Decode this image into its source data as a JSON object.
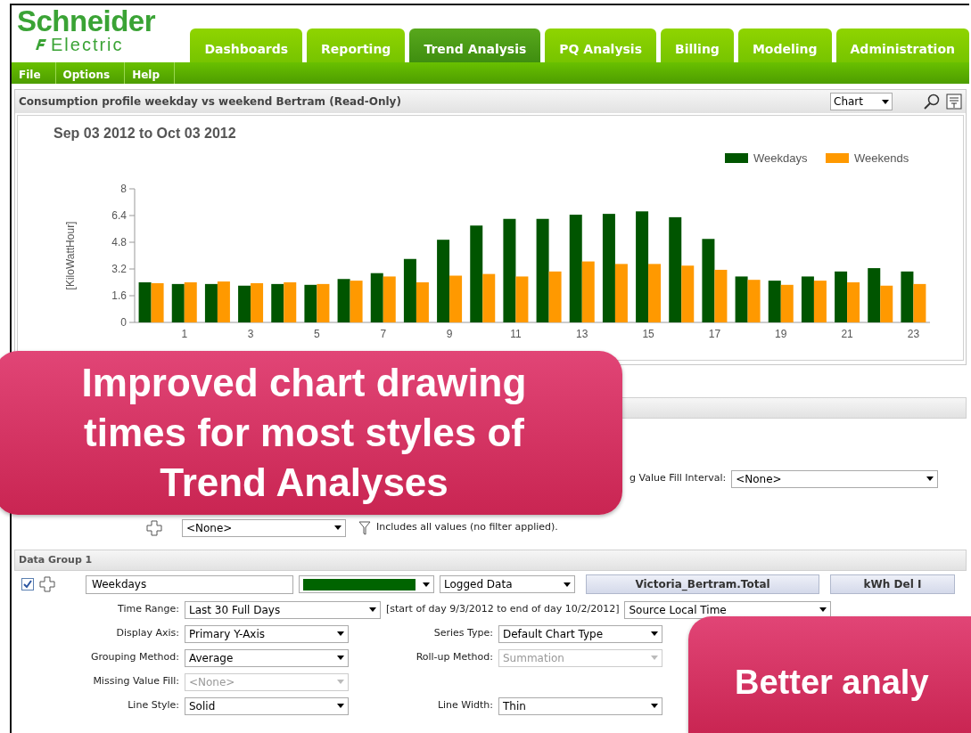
{
  "logo": {
    "name": "Schneider",
    "sub": "Electric"
  },
  "tabs": [
    {
      "label": "Dashboards",
      "selected": false
    },
    {
      "label": "Reporting",
      "selected": false
    },
    {
      "label": "Trend Analysis",
      "selected": true
    },
    {
      "label": "PQ Analysis",
      "selected": false
    },
    {
      "label": "Billing",
      "selected": false
    },
    {
      "label": "Modeling",
      "selected": false
    },
    {
      "label": "Administration",
      "selected": false
    }
  ],
  "menu": [
    "File",
    "Options",
    "Help"
  ],
  "panel": {
    "title": "Consumption profile weekday vs weekend Bertram (Read-Only)",
    "view": "Chart",
    "chart_title": "Sep 03 2012 to Oct 03 2012",
    "chart_data": {
      "type": "bar",
      "ylabel": "[KiloWattHour]",
      "legend": "top-right",
      "x": [
        0,
        1,
        2,
        3,
        4,
        5,
        6,
        7,
        8,
        9,
        10,
        11,
        12,
        13,
        14,
        15,
        16,
        17,
        18,
        19,
        20,
        21,
        22,
        23
      ],
      "xlim": [
        -0.5,
        23.5
      ],
      "ylim": [
        0,
        8
      ],
      "yticks": [
        0,
        1.6,
        3.2,
        4.8,
        6.4,
        8
      ],
      "xticks": [
        1,
        3,
        5,
        7,
        9,
        11,
        13,
        15,
        17,
        19,
        21,
        23
      ],
      "series": [
        {
          "name": "Weekdays",
          "color": "#005500",
          "values": [
            2.4,
            2.3,
            2.3,
            2.2,
            2.3,
            2.25,
            2.6,
            2.95,
            3.8,
            4.95,
            5.8,
            6.2,
            6.2,
            6.45,
            6.5,
            6.65,
            6.3,
            5.0,
            2.75,
            2.5,
            2.75,
            3.05,
            3.25,
            3.05
          ]
        },
        {
          "name": "Weekends",
          "color": "#ff9900",
          "values": [
            2.35,
            2.4,
            2.45,
            2.35,
            2.4,
            2.3,
            2.5,
            2.75,
            2.4,
            2.8,
            2.9,
            2.75,
            3.05,
            3.65,
            3.5,
            3.5,
            3.4,
            3.15,
            2.55,
            2.25,
            2.5,
            2.4,
            2.2,
            2.3
          ]
        }
      ]
    }
  },
  "chart_options": {
    "fill_label": "g Value Fill Interval:",
    "fill_value": "<None>",
    "filter_value": "<None>",
    "filter_text": "Includes all values (no filter applied)."
  },
  "data_group": {
    "title": "Data Group 1",
    "checked": true,
    "name": "Weekdays",
    "color": "#006400",
    "source": "Logged Data",
    "buttons": [
      "Victoria_Bertram.Total",
      "kWh Del I"
    ],
    "rows": [
      {
        "items": [
          {
            "kind": "field",
            "label": "Time Range:",
            "value": "Last 30 Full Days",
            "disabled": false
          },
          {
            "kind": "note",
            "text": "[start of day 9/3/2012 to end of day 10/2/2012]"
          },
          {
            "kind": "field",
            "value": "Source Local Time",
            "disabled": false
          }
        ]
      },
      {
        "items": [
          {
            "kind": "field",
            "label": "Display Axis:",
            "value": "Primary Y-Axis",
            "disabled": false
          },
          {
            "kind": "field",
            "label": "Series Type:",
            "value": "Default Chart Type",
            "disabled": false
          }
        ]
      },
      {
        "items": [
          {
            "kind": "field",
            "label": "Grouping Method:",
            "value": "Average",
            "disabled": false
          },
          {
            "kind": "field",
            "label": "Roll-up Method:",
            "value": "Summation",
            "disabled": true
          }
        ]
      },
      {
        "items": [
          {
            "kind": "field",
            "label": "Missing Value Fill:",
            "value": "<None>",
            "disabled": true
          }
        ]
      },
      {
        "items": [
          {
            "kind": "field",
            "label": "Line Style:",
            "value": "Solid",
            "disabled": false
          },
          {
            "kind": "field",
            "label": "Line Width:",
            "value": "Thin",
            "disabled": false
          }
        ]
      }
    ]
  },
  "callouts": [
    {
      "text": "Improved chart drawing times for most styles of Trend Analyses"
    },
    {
      "text": "Better analy"
    }
  ]
}
